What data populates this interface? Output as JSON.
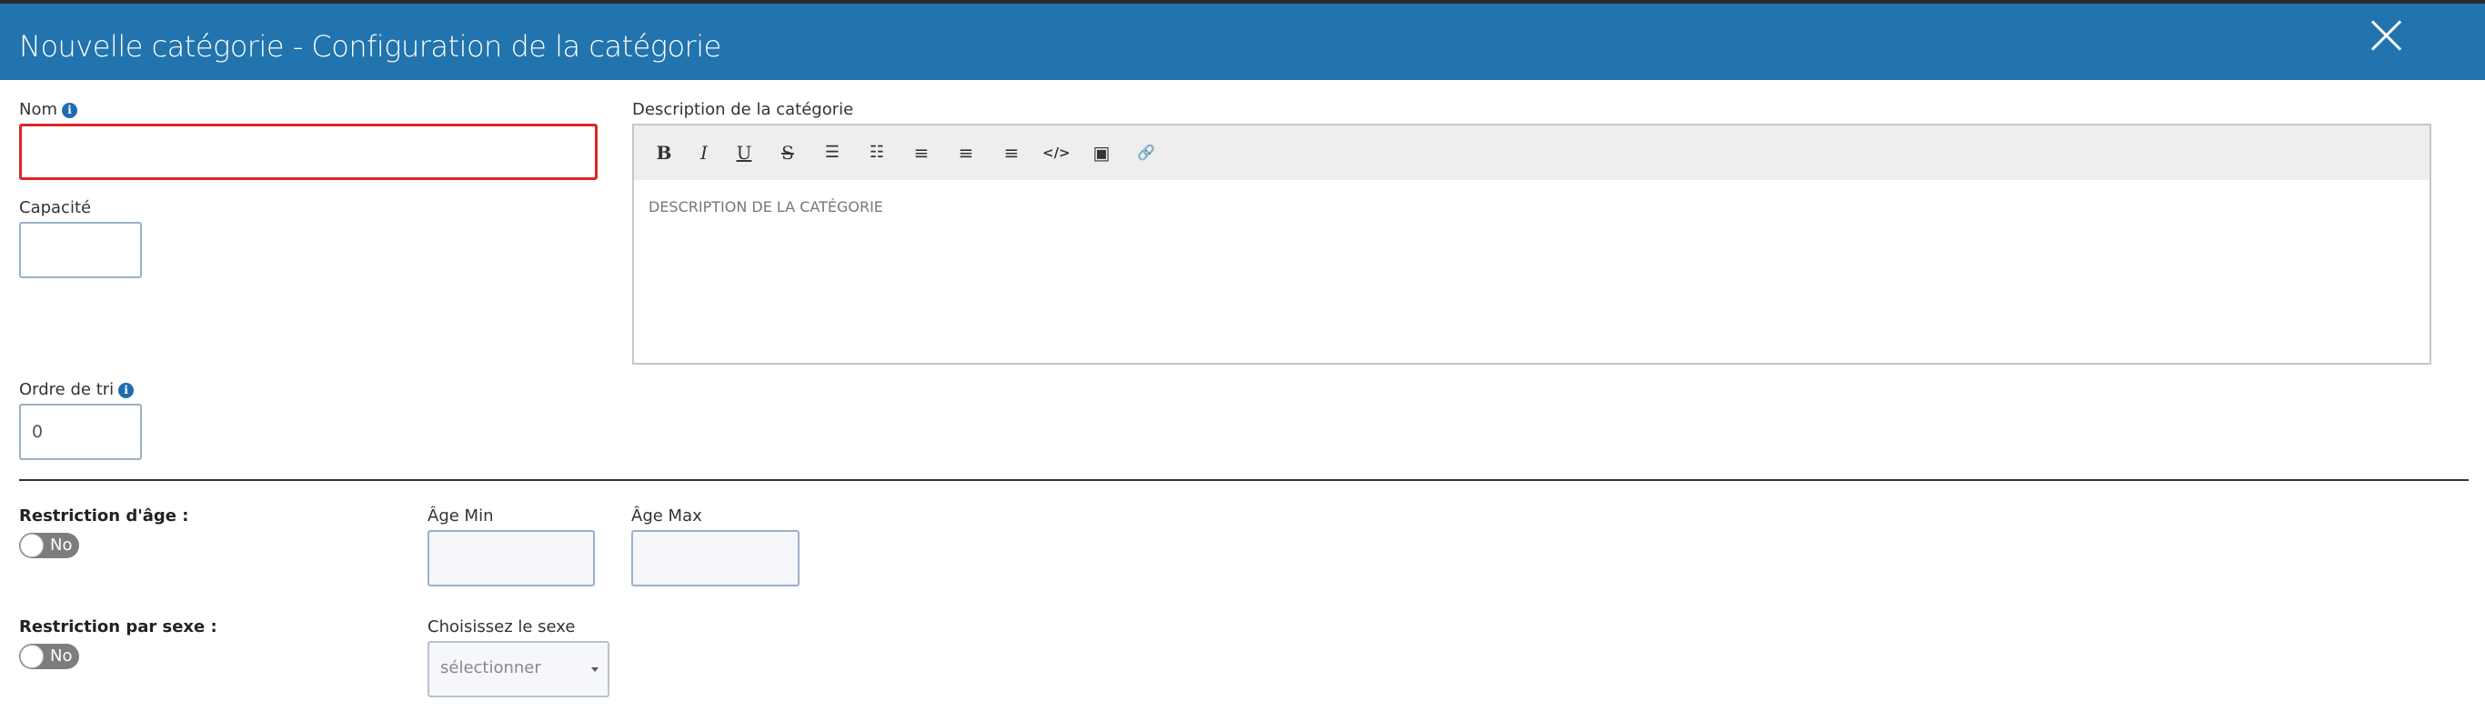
{
  "header": {
    "title": "Nouvelle catégorie - Configuration de la catégorie"
  },
  "form": {
    "nom": {
      "label": "Nom",
      "value": ""
    },
    "capacite": {
      "label": "Capacité",
      "value": ""
    },
    "ordre": {
      "label": "Ordre de tri",
      "value": "0"
    },
    "description": {
      "label": "Description de la catégorie",
      "placeholder": "DESCRIPTION DE LA CATÉGORIE"
    },
    "age": {
      "label": "Restriction d'âge :",
      "toggle": "No",
      "min_label": "Âge Min",
      "max_label": "Âge Max",
      "min_value": "",
      "max_value": ""
    },
    "sexe": {
      "label": "Restriction par sexe :",
      "toggle": "No",
      "choose_label": "Choisissez le sexe",
      "select_value": "sélectionner"
    }
  },
  "toolbar": {
    "bold": "B",
    "italic": "I",
    "underline": "U",
    "strike": "S",
    "bullets": "☰",
    "numbered": "☷",
    "align_left": "≡",
    "align_center": "≡",
    "align_right": "≡",
    "code": "</>",
    "image": "▣",
    "link": "🔗"
  },
  "colors": {
    "header": "#2174ad",
    "error": "#e02424",
    "toggle": "#7d7d7d"
  }
}
